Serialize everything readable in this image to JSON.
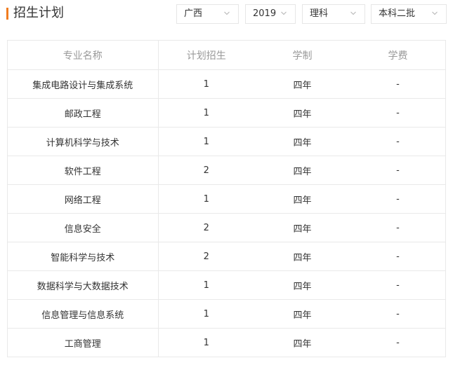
{
  "header": {
    "title": "招生计划",
    "accent_color": "#f07c1f"
  },
  "filters": {
    "province": "广西",
    "year": "2019",
    "subject": "理科",
    "batch": "本科二批",
    "chevron_icon": "chevron-down-icon"
  },
  "table": {
    "columns": [
      "专业名称",
      "计划招生",
      "学制",
      "学费"
    ],
    "rows": [
      {
        "major": "集成电路设计与集成系统",
        "plan": "1",
        "duration": "四年",
        "fee": "-"
      },
      {
        "major": "邮政工程",
        "plan": "1",
        "duration": "四年",
        "fee": "-"
      },
      {
        "major": "计算机科学与技术",
        "plan": "1",
        "duration": "四年",
        "fee": "-"
      },
      {
        "major": "软件工程",
        "plan": "2",
        "duration": "四年",
        "fee": "-"
      },
      {
        "major": "网络工程",
        "plan": "1",
        "duration": "四年",
        "fee": "-"
      },
      {
        "major": "信息安全",
        "plan": "2",
        "duration": "四年",
        "fee": "-"
      },
      {
        "major": "智能科学与技术",
        "plan": "2",
        "duration": "四年",
        "fee": "-"
      },
      {
        "major": "数据科学与大数据技术",
        "plan": "1",
        "duration": "四年",
        "fee": "-"
      },
      {
        "major": "信息管理与信息系统",
        "plan": "1",
        "duration": "四年",
        "fee": "-"
      },
      {
        "major": "工商管理",
        "plan": "1",
        "duration": "四年",
        "fee": "-"
      }
    ]
  }
}
